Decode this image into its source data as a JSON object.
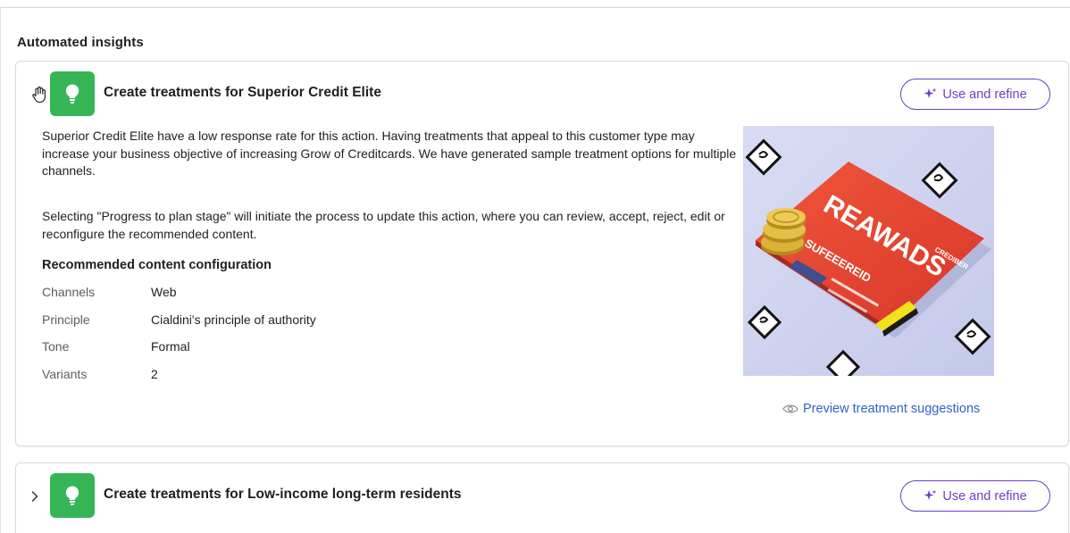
{
  "panel": {
    "title": "Automated insights"
  },
  "insights": [
    {
      "title": "Create treatments for Superior Credit Elite",
      "button_label": "Use and refine",
      "paragraph1": "Superior Credit Elite have a low response rate for this action. Having treatments that appeal to this customer type may increase your business objective of increasing Grow of Creditcards. We have generated sample treatment options for multiple channels.",
      "paragraph2": "Selecting \"Progress to plan stage\" will initiate the process to update this action, where you can review, accept, reject, edit or reconfigure the recommended content.",
      "config_heading": "Recommended content configuration",
      "config": [
        {
          "key": "Channels",
          "value": "Web"
        },
        {
          "key": "Principle",
          "value": "Cialdini's principle of authority"
        },
        {
          "key": "Tone",
          "value": "Formal"
        },
        {
          "key": "Variants",
          "value": "2"
        }
      ],
      "preview_link": "Preview treatment suggestions",
      "image_text": {
        "big": "REAWADS",
        "small": "SUFEEEREID",
        "tiny": "CREDIBER"
      }
    },
    {
      "title": "Create treatments for Low-income long-term residents",
      "button_label": "Use and refine"
    }
  ],
  "colors": {
    "accent": "#6a3fc7",
    "link": "#2f63c8",
    "bulb": "#36b556",
    "card_red": "#e8452f"
  },
  "icons": [
    "hand-pointer-icon",
    "lightbulb-icon",
    "sparkle-icon",
    "eye-icon",
    "chevron-right-icon"
  ]
}
